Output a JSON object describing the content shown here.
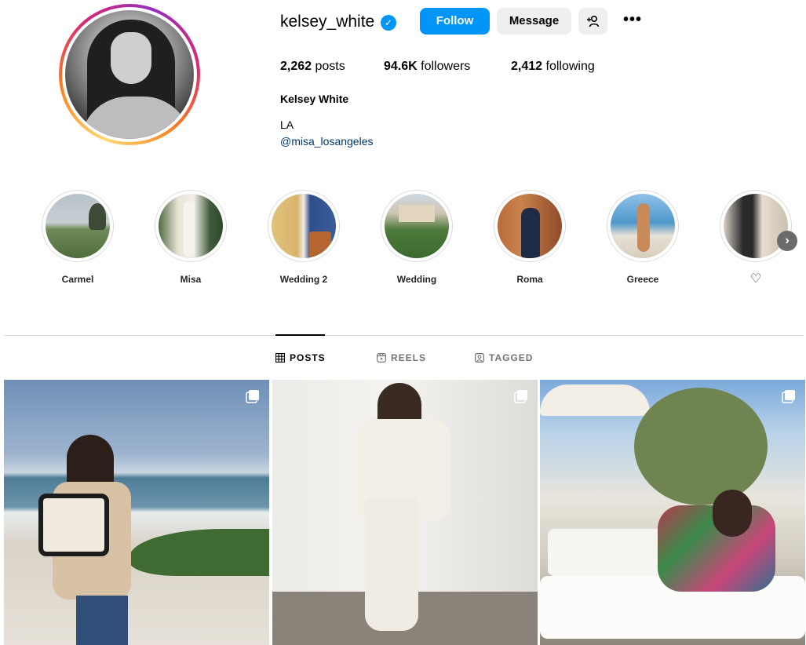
{
  "profile": {
    "username": "kelsey_white",
    "verified": true,
    "full_name": "Kelsey White",
    "bio_line": "LA",
    "bio_link": "@misa_losangeles",
    "stats": {
      "posts_value": "2,262",
      "posts_label": "posts",
      "followers_value": "94.6K",
      "followers_label": "followers",
      "following_value": "2,412",
      "following_label": "following"
    }
  },
  "actions": {
    "follow_label": "Follow",
    "message_label": "Message",
    "suggest_icon": "add-person-icon",
    "more_icon": "more-horizontal-icon",
    "more_glyph": "•••"
  },
  "highlights": [
    {
      "label": "Carmel"
    },
    {
      "label": "Misa"
    },
    {
      "label": "Wedding 2"
    },
    {
      "label": "Wedding"
    },
    {
      "label": "Roma"
    },
    {
      "label": "Greece"
    },
    {
      "label": "♡"
    }
  ],
  "tabs": [
    {
      "label": "POSTS",
      "icon": "grid-icon",
      "active": true
    },
    {
      "label": "REELS",
      "icon": "reels-icon",
      "active": false
    },
    {
      "label": "TAGGED",
      "icon": "tagged-icon",
      "active": false
    }
  ],
  "colors": {
    "accent": "#0095f6",
    "link": "#00376b",
    "secondary_button": "#efefef",
    "divider": "#dbdbdb"
  }
}
